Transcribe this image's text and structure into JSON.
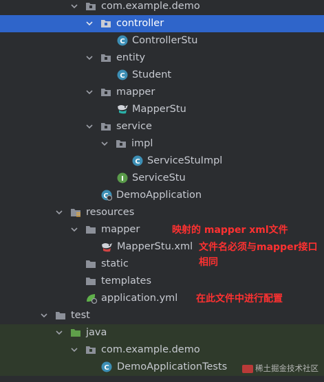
{
  "tree": {
    "items": [
      {
        "label": "com.example.demo"
      },
      {
        "label": "controller"
      },
      {
        "label": "ControllerStu"
      },
      {
        "label": "entity"
      },
      {
        "label": "Student"
      },
      {
        "label": "mapper"
      },
      {
        "label": "MapperStu"
      },
      {
        "label": "service"
      },
      {
        "label": "impl"
      },
      {
        "label": "ServiceStuImpl"
      },
      {
        "label": "ServiceStu"
      },
      {
        "label": "DemoApplication"
      },
      {
        "label": "resources"
      },
      {
        "label": "mapper"
      },
      {
        "label": "MapperStu.xml"
      },
      {
        "label": "static"
      },
      {
        "label": "templates"
      },
      {
        "label": "application.yml"
      },
      {
        "label": "test"
      },
      {
        "label": "java"
      },
      {
        "label": "com.example.demo"
      },
      {
        "label": "DemoApplicationTests"
      }
    ]
  },
  "annotations": {
    "mapper_note": "映射的 mapper xml文件",
    "filename_note_line1": "文件名必须与mapper接口",
    "filename_note_line2": "相同",
    "config_note": "在此文件中进行配置"
  },
  "watermark": "稀土掘金技术社区",
  "colors": {
    "background": "#2b2d30",
    "selection": "#2f65ca",
    "test_area": "#2f3a2b",
    "annotation": "#ff3131"
  },
  "icons": {
    "package": "package-folder-icon",
    "folder": "folder-icon",
    "class": "java-class-icon",
    "interface": "java-interface-icon",
    "mybatis": "mybatis-mapper-icon",
    "spring_app": "spring-boot-app-icon",
    "resources": "resources-folder-icon",
    "xml": "mybatis-xml-icon",
    "yml": "spring-config-icon",
    "test_folder": "test-java-folder-icon"
  }
}
